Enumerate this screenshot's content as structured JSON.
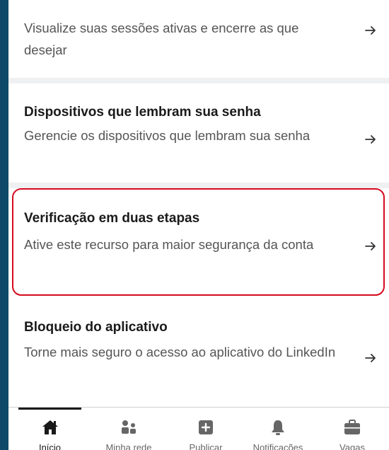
{
  "sections": [
    {
      "title": "",
      "description": "Visualize suas sessões ativas e encerre as que desejar"
    },
    {
      "title": "Dispositivos que lembram sua senha",
      "description": "Gerencie os dispositivos que lembram sua senha"
    },
    {
      "title": "Verificação em duas etapas",
      "description": "Ative este recurso para maior segurança da conta"
    },
    {
      "title": "Bloqueio do aplicativo",
      "description": "Torne mais seguro o acesso ao aplicativo do LinkedIn"
    }
  ],
  "tabbar": {
    "items": [
      {
        "label": "Início",
        "icon": "home-icon",
        "active": true
      },
      {
        "label": "Minha rede",
        "icon": "network-icon",
        "active": false
      },
      {
        "label": "Publicar",
        "icon": "post-icon",
        "active": false
      },
      {
        "label": "Notificações",
        "icon": "bell-icon",
        "active": false
      },
      {
        "label": "Vagas",
        "icon": "briefcase-icon",
        "active": false
      }
    ]
  },
  "colors": {
    "highlight": "#d60a1e",
    "background_edge": "#0e4a68",
    "text_primary": "#1a1a1a",
    "text_secondary": "#555555"
  }
}
